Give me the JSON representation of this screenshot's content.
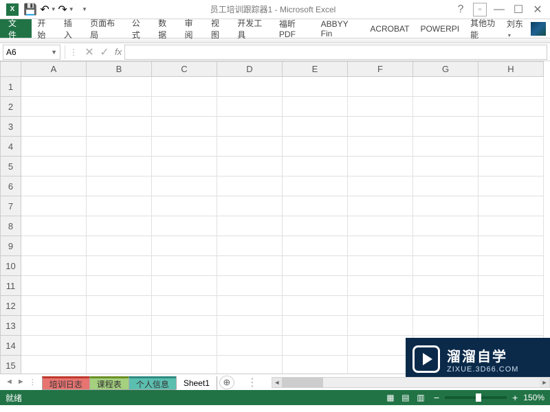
{
  "title": "员工培训跟踪器1 - Microsoft Excel",
  "qat": {
    "save": "💾",
    "undo": "↶",
    "redo": "↷"
  },
  "ribbon": {
    "file": "文件",
    "tabs": [
      "开始",
      "插入",
      "页面布局",
      "公式",
      "数据",
      "审阅",
      "视图",
      "开发工具",
      "福昕PDF",
      "ABBYY Fin",
      "ACROBAT",
      "POWERPI",
      "其他功能"
    ],
    "user": "刘东"
  },
  "formula": {
    "name_box": "A6",
    "fx": "fx",
    "cancel": "✕",
    "enter": "✓",
    "value": ""
  },
  "grid": {
    "cols": [
      "A",
      "B",
      "C",
      "D",
      "E",
      "F",
      "G",
      "H"
    ],
    "rows": [
      "1",
      "2",
      "3",
      "4",
      "5",
      "6",
      "7",
      "8",
      "9",
      "10",
      "11",
      "12",
      "13",
      "14",
      "15"
    ]
  },
  "sheets": {
    "nav_prev": "◄",
    "nav_next": "►",
    "tabs": [
      {
        "label": "培训日志",
        "cls": "tab-red"
      },
      {
        "label": "课程表",
        "cls": "tab-green"
      },
      {
        "label": "个人信息",
        "cls": "tab-teal"
      },
      {
        "label": "Sheet1",
        "cls": "tab-active"
      }
    ],
    "new": "⊕"
  },
  "status": {
    "ready": "就绪",
    "zoom": "150%"
  },
  "watermark": {
    "big": "溜溜自学",
    "small": "ZIXUE.3D66.COM"
  }
}
